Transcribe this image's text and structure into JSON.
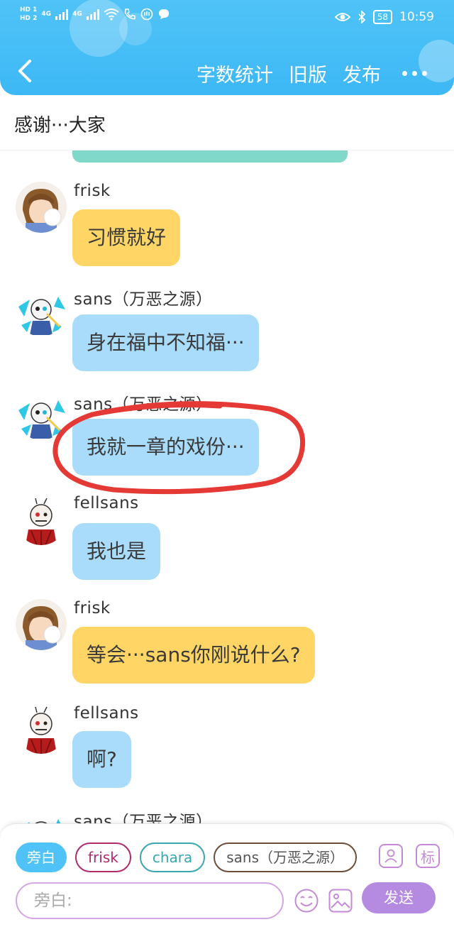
{
  "status_bar": {
    "sim1": "HD 1",
    "sim2": "HD 2",
    "net1": "4G",
    "net2": "4G",
    "battery": "58",
    "time": "10:59"
  },
  "toolbar": {
    "word_count": "字数统计",
    "old_version": "旧版",
    "publish": "发布"
  },
  "title": "感谢···大家",
  "messages": [
    {
      "name": "frisk",
      "text": "习惯就好",
      "color": "yellow"
    },
    {
      "name": "sans（万恶之源）",
      "text": "身在福中不知福···",
      "color": "blue"
    },
    {
      "name": "sans（万恶之源）",
      "text": "我就一章的戏份···",
      "color": "blue"
    },
    {
      "name": "fellsans",
      "text": "我也是",
      "color": "blue"
    },
    {
      "name": "frisk",
      "text": "等会···sans你刚说什么?",
      "color": "yellow"
    },
    {
      "name": "fellsans",
      "text": "啊?",
      "color": "blue"
    },
    {
      "name": "sans（万恶之源）",
      "text": "",
      "color": "blue"
    }
  ],
  "roles": {
    "narrator": "旁白",
    "frisk": "frisk",
    "chara": "chara",
    "sans": "sans（万恶之源）"
  },
  "tools": {
    "mark": "标"
  },
  "input": {
    "placeholder": "旁白:"
  },
  "send": "发送",
  "colors": {
    "header": "#4fc3f7",
    "yellow_bubble": "#ffd665",
    "blue_bubble": "#a8dcfa",
    "accent_purple": "#b48be0",
    "annotation_red": "#e53935"
  }
}
